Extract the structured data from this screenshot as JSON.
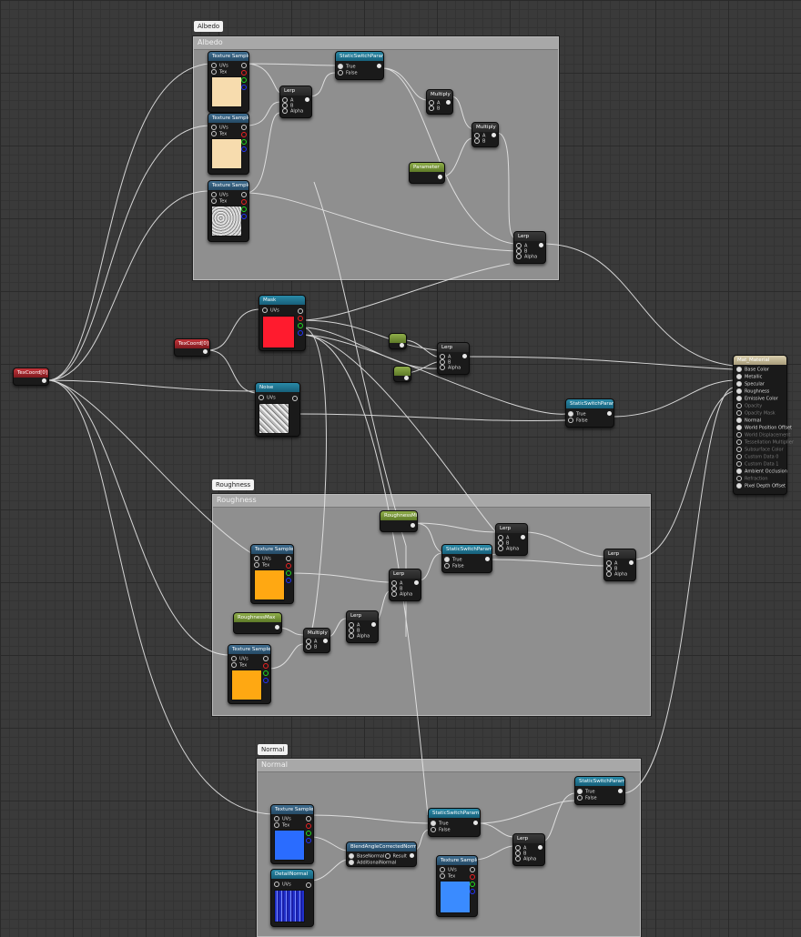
{
  "comments": {
    "albedo": {
      "tag": "Albedo",
      "title": "Albedo"
    },
    "roughness": {
      "tag": "Roughness",
      "title": "Roughness"
    },
    "normal": {
      "tag": "Normal",
      "title": "Normal"
    }
  },
  "nodes": {
    "tex_sample": "Texture Sample",
    "uvs": "UVs",
    "tex": "Tex",
    "lerp": "Lerp",
    "multiply": "Multiply",
    "static_switch": "StaticSwitchParam",
    "true": "True",
    "false": "False",
    "a": "A",
    "b": "B",
    "alpha": "Alpha",
    "param_green": "Parameter",
    "mask": "Mask",
    "noise": "Noise",
    "texcoord": "TexCoord[0]",
    "blend_normal": "BlendAngleCorrectedNormals",
    "base_normal": "BaseNormal",
    "additional_normal": "AdditionalNormal",
    "result": "Result",
    "detail_normal": "DetailNormal",
    "roughness_param": "RoughnessMin",
    "roughness_param2": "RoughnessMax"
  },
  "material": {
    "title": "Mat_Material",
    "pins": [
      "Base Color",
      "Metallic",
      "Specular",
      "Roughness",
      "Emissive Color",
      "Opacity",
      "Opacity Mask",
      "Normal",
      "World Position Offset",
      "World Displacement",
      "Tessellation Multiplier",
      "Subsurface Color",
      "Custom Data 0",
      "Custom Data 1",
      "Ambient Occlusion",
      "Refraction",
      "Pixel Depth Offset"
    ]
  },
  "colors": {
    "wire": "#e6e6e6",
    "albedo_swatch": "#f7dcae",
    "mask_swatch": "#ff1b2e",
    "roughness_swatch": "#ffa812",
    "normal_swatch": "#2a6cff"
  }
}
